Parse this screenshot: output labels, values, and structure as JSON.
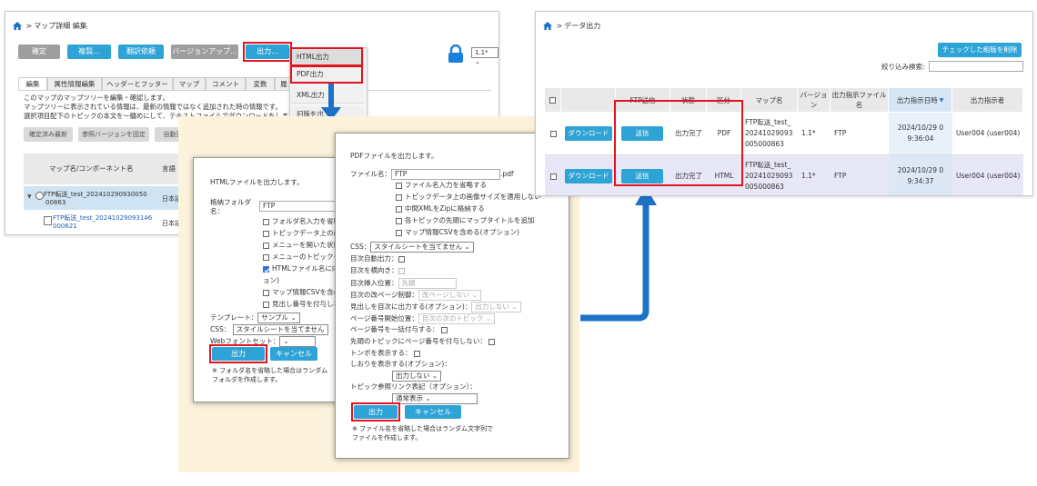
{
  "editor": {
    "breadcrumb": {
      "sep": ">",
      "label": "マップ詳細 編集"
    },
    "toolbar": {
      "confirm": "確定",
      "copy": "複製...",
      "translate": "翻訳依頼",
      "version_up": "バージョンアップ...",
      "output": "出力..."
    },
    "version_select": "1.1*",
    "tabs": [
      "編集",
      "属性情報編集",
      "ヘッダーとフッター",
      "マップ",
      "コメント",
      "変数",
      "履"
    ],
    "description": [
      "このマップのマップツリーを編集・確認します。",
      "マップツリーに表示されている情報は、最新の情報ではなく追加された時の情報です。",
      "選択項目配下のトピックの本文を一纏めにして、テキストファイルでダウンロードをします。"
    ],
    "subbuttons": {
      "latest": "確定済み最新",
      "reference": "参照バージョンを固定",
      "auto": "自動更"
    },
    "table_headers": {
      "name": "マップ名/コンポーネント名",
      "lang": "言語"
    },
    "rows": [
      {
        "name_line1": "FTP転送_test_202410290930050",
        "name_line2": "00863",
        "lang": "日本語"
      },
      {
        "name_line1": "FTP転送_test_20241029093146",
        "name_line2": "000621",
        "lang": "日本語"
      }
    ],
    "output_menu": [
      "HTML出力",
      "PDF出力",
      "XML出力",
      "旧版を出"
    ]
  },
  "html_dialog": {
    "heading": "HTMLファイルを出力します。",
    "folder_label_1": "格納フォルダ",
    "folder_label_2": "名：",
    "folder_value": "FTP",
    "options": [
      {
        "label": "フォルダ名入力を省略",
        "checked": false
      },
      {
        "label": "トピックデータ上の画",
        "checked": false
      },
      {
        "label": "メニューを開いた状態",
        "checked": false
      },
      {
        "label": "メニューのトピックタ",
        "checked": false
      },
      {
        "label": "HTMLファイル名に内",
        "checked": true
      }
    ],
    "wrap_text": "ョン)",
    "options2": [
      {
        "label": "マップ情報CSVを含め",
        "checked": false
      },
      {
        "label": "見出し番号を付与しな",
        "checked": false
      }
    ],
    "template_label": "テンプレート：",
    "template_value": "サンプル",
    "css_label": "CSS：",
    "css_value": "スタイルシートを当てません",
    "webfont_label": "Webフォントセット：",
    "webfont_value": "",
    "output_button": "出力",
    "cancel_button": "キャンセル",
    "note_1": "※ フォルダ名を省略した場合はランダム",
    "note_2": "フォルダを作成します。"
  },
  "pdf_dialog": {
    "heading": "PDFファイルを出力します。",
    "filename_label": "ファイル名：",
    "filename_value": "FTP",
    "filename_ext": ".pdf",
    "options": [
      {
        "label": "ファイル名入力を省略する",
        "checked": false
      },
      {
        "label": "トピックデータ上の画像サイズを適用しない",
        "checked": false
      },
      {
        "label": "中間XMLをZipに格納する",
        "checked": false
      },
      {
        "label": "各トピックの先頭にマップタイトルを追加",
        "checked": false
      },
      {
        "label": "マップ情報CSVを含める(オプション)",
        "checked": false
      }
    ],
    "css_label": "CSS：",
    "css_value": "スタイルシートを当てません",
    "toc_auto": "目次自動出力：",
    "toc_horizontal": "目次を横向き：",
    "toc_insert_label": "目次挿入位置：",
    "toc_insert_value": "先頭",
    "toc_page_label": "目次の改ページ制御：",
    "toc_page_value": "改ページしない",
    "heading_out_label": "見出しを目次に出力する(オプション)：",
    "heading_out_value": "出力しない",
    "page_start_label": "ページ番号開始位置：",
    "page_start_value": "目次の次のトピック",
    "page_all_label": "ページ番号を一括付与する：",
    "page_head_label": "先頭のトピックにページ番号を付与しない：",
    "tombo_label": "トンボを表示する：",
    "bookmark_label": "しおりを表示する(オプション)：",
    "bookmark_value": "出力しない",
    "link_label": "トピック参照リンク表記（オプション）：",
    "link_value": "通常表示",
    "output_button": "出力",
    "cancel_button": "キャンセル",
    "note_1": "※ ファイル名を省略した場合はランダム文字列で",
    "note_2": "ファイルを作成します。"
  },
  "data_output": {
    "breadcrumb": {
      "sep": ">",
      "label": "データ出力"
    },
    "delete_button": "チェックした組版を削除",
    "filter_label": "絞り込み検索:",
    "filter_value": "",
    "headers": [
      "",
      "",
      "FTP送信",
      "状態",
      "区分",
      "マップ名",
      "バージョン",
      "出力指示ファイル名",
      "出力指示日時",
      "出力指示者"
    ],
    "rows": [
      {
        "download": "ダウンロード",
        "send": "送信",
        "status": "出力完了",
        "type": "PDF",
        "map1": "FTP転送_test_",
        "map2": "20241029093",
        "map3": "005000863",
        "version": "1.1*",
        "file": "FTP",
        "date1": "2024/10/29 0",
        "date2": "9:36:04",
        "user": "User004 (user004)"
      },
      {
        "download": "ダウンロード",
        "send": "送信",
        "status": "出力完了",
        "type": "HTML",
        "map1": "FTP転送_test_",
        "map2": "20241029093",
        "map3": "005000863",
        "version": "1.1*",
        "file": "FTP",
        "date1": "2024/10/29 0",
        "date2": "9:34:37",
        "user": "User004 (user004)"
      }
    ]
  },
  "colors": {
    "accent_blue": "#2ea3d6",
    "highlight_red": "#e3141e",
    "arrow_blue": "#1c72c7",
    "backdrop": "#fdf3dc"
  }
}
